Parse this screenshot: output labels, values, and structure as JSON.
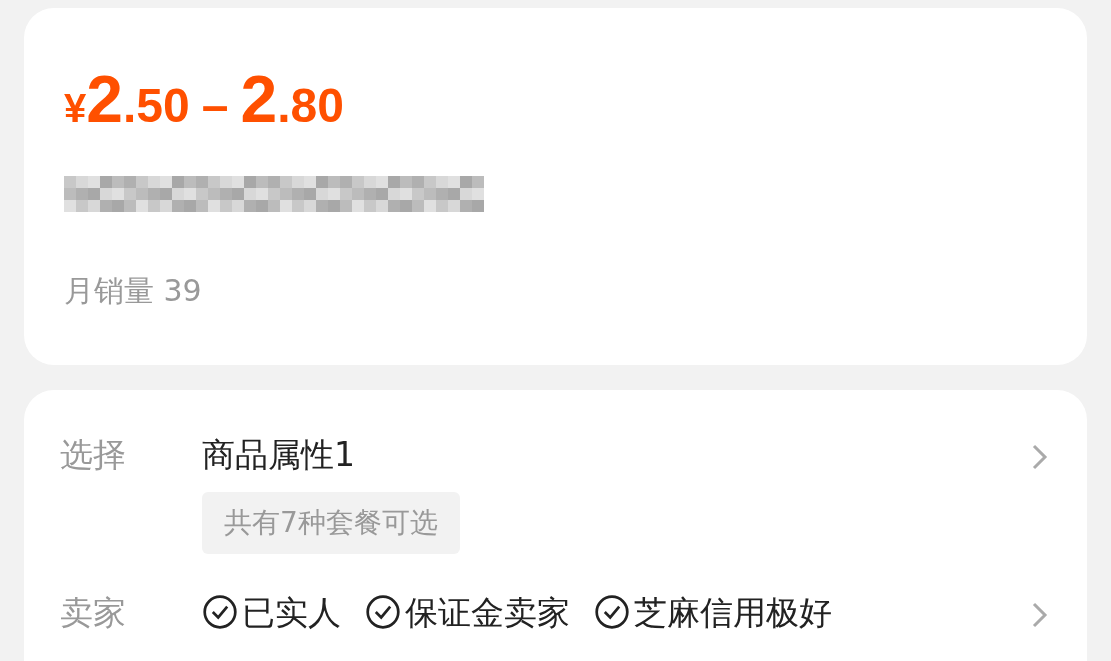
{
  "price": {
    "currency": "¥",
    "low_integer": "2",
    "low_decimal": ".50",
    "separator": "–",
    "high_integer": "2",
    "high_decimal": ".80"
  },
  "monthly_sales": {
    "label": "月销量",
    "value": "39"
  },
  "options": [
    {
      "kind": "select",
      "label": "选择",
      "value": "商品属性1",
      "tag": "共有7种套餐可选"
    },
    {
      "kind": "badges",
      "label": "卖家",
      "badges": [
        "已实人",
        "保证金卖家",
        "芝麻信用极好"
      ]
    }
  ]
}
